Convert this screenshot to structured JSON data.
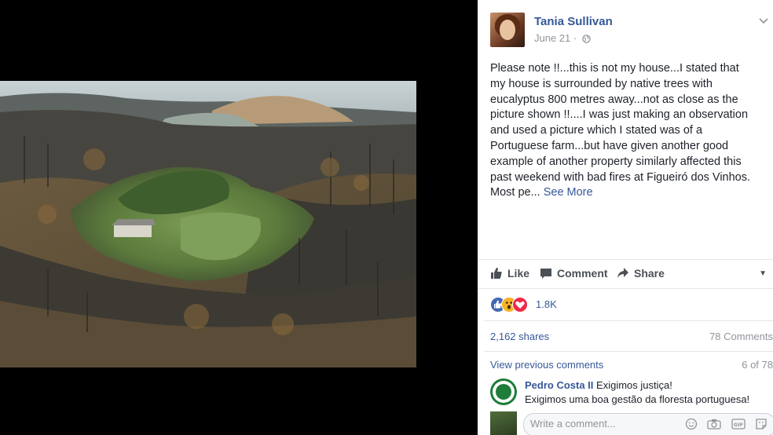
{
  "post": {
    "author": "Tania Sullivan",
    "date": "June 21",
    "privacy_icon": "globe-icon",
    "text_lines": [
      "Please note !!...this is not my house...I stated that",
      "my house is surrounded by native trees with",
      "eucalyptus 800 metres away...not as close as the",
      "picture shown !!....I was just making an observation",
      "and used a picture which I stated was of a",
      "Portuguese farm...but have given another good",
      "example of another property similarly affected this",
      "past weekend with bad fires at Figueiró dos Vinhos."
    ],
    "text_last": "Most pe...",
    "see_more": "See More"
  },
  "actions": {
    "like": "Like",
    "comment": "Comment",
    "share": "Share"
  },
  "reactions": {
    "icons": [
      "like-reaction-icon",
      "wow-reaction-icon",
      "love-reaction-icon"
    ],
    "count": "1.8K"
  },
  "stats": {
    "shares": "2,162 shares",
    "comments": "78 Comments"
  },
  "comments_section": {
    "view_previous": "View previous comments",
    "page": "6 of 78",
    "items": [
      {
        "author": "Pedro Costa II",
        "line1": "Exigimos justiça!",
        "line2": "Exigimos uma boa gestão da floresta portuguesa!"
      }
    ],
    "composer_placeholder": "Write a comment..."
  },
  "colors": {
    "link": "#365899",
    "text": "#1d2129",
    "muted": "#90949c",
    "like_blue": "#4267b2",
    "love_red": "#f0284a",
    "wow_yellow": "#f7b125"
  }
}
